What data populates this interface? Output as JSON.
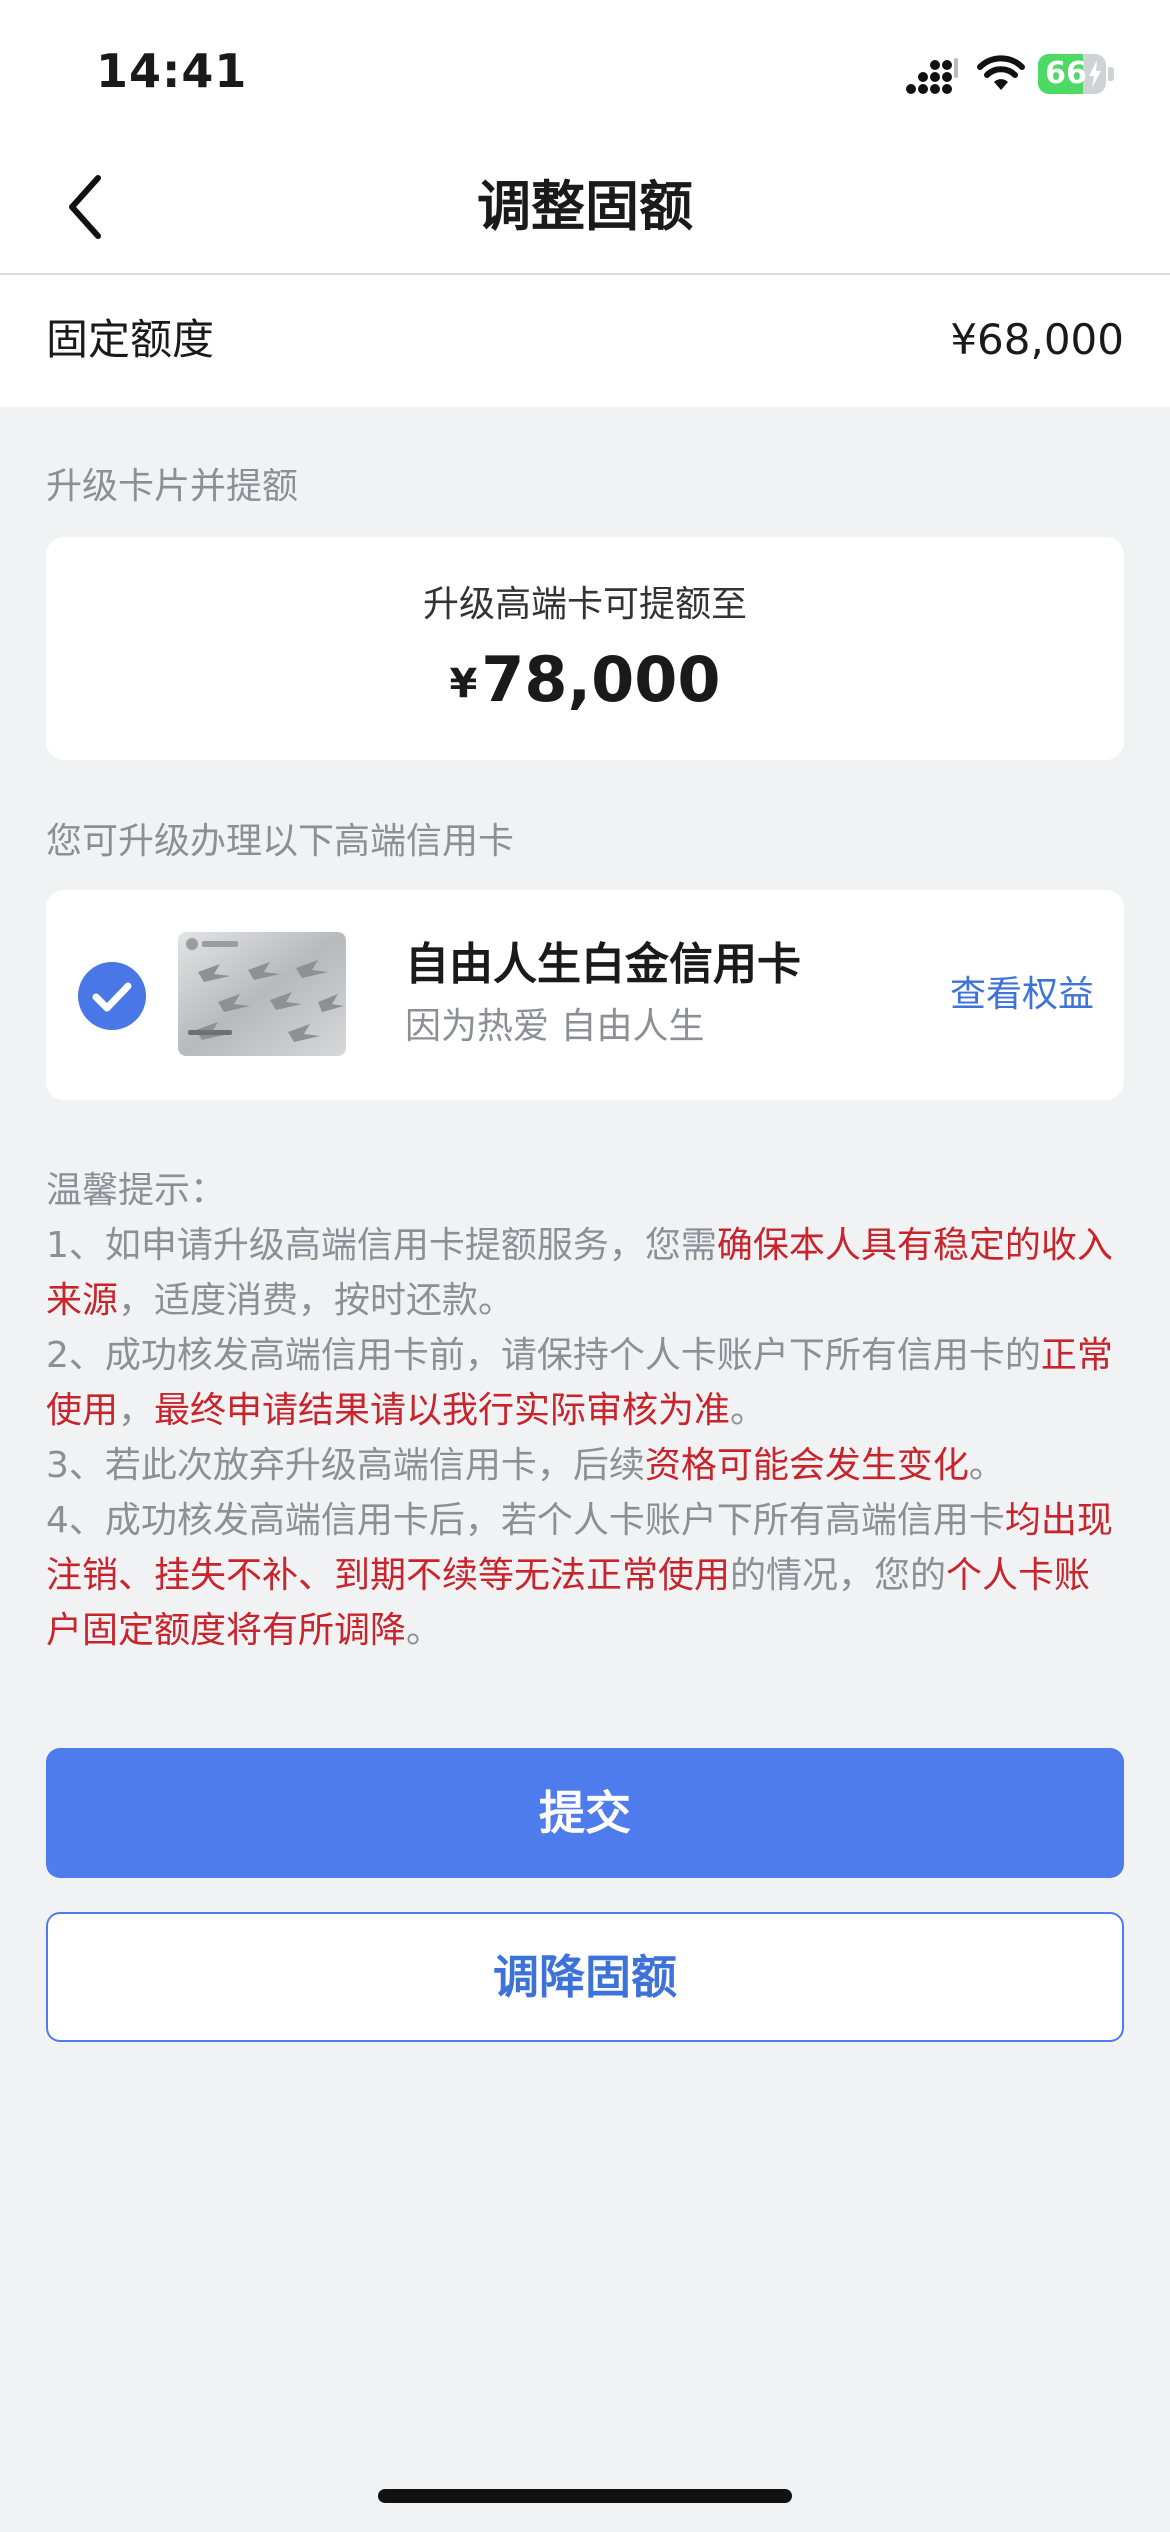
{
  "status_bar": {
    "time": "14:41",
    "battery_level": "66",
    "battery_fill_percent": 66,
    "icons": [
      "signal-icon",
      "wifi-icon",
      "battery-charging-icon"
    ]
  },
  "nav": {
    "title": "调整固额",
    "back_icon": "chevron-left-icon"
  },
  "fixed_limit": {
    "label": "固定额度",
    "value": "¥68,000"
  },
  "upgrade_section": {
    "label": "升级卡片并提额",
    "card_text": "升级高端卡可提额至",
    "amount_symbol": "¥",
    "amount": "78,000"
  },
  "card_section": {
    "label": "您可升级办理以下高端信用卡",
    "card": {
      "name": "自由人生白金信用卡",
      "slogan": "因为热爱 自由人生",
      "link_label": "查看权益",
      "selected": true
    }
  },
  "tips": {
    "title": "温馨提示：",
    "items": [
      [
        {
          "text": "1、如申请升级高端信用卡提额服务，您需",
          "red": false
        },
        {
          "text": "确保本人具有稳定的收入来源",
          "red": true
        },
        {
          "text": "，适度消费，按时还款。",
          "red": false
        }
      ],
      [
        {
          "text": "2、成功核发高端信用卡前，请保持个人卡账户下所有信用卡的",
          "red": false
        },
        {
          "text": "正常使用",
          "red": true
        },
        {
          "text": "，",
          "red": false
        },
        {
          "text": "最终申请结果请以我行实际审核为准",
          "red": true
        },
        {
          "text": "。",
          "red": false
        }
      ],
      [
        {
          "text": "3、若此次放弃升级高端信用卡，后续",
          "red": false
        },
        {
          "text": "资格可能会发生变化",
          "red": true
        },
        {
          "text": "。",
          "red": false
        }
      ],
      [
        {
          "text": "4、成功核发高端信用卡后，若个人卡账户下所有高端信用卡",
          "red": false
        },
        {
          "text": "均出现注销、挂失不补、到期不续等无法正常使用",
          "red": true
        },
        {
          "text": "的情况，您的",
          "red": false
        },
        {
          "text": "个人卡账户固定额度将有所调降",
          "red": true
        },
        {
          "text": "。",
          "red": false
        }
      ]
    ]
  },
  "buttons": {
    "submit": "提交",
    "lower_limit": "调降固额"
  },
  "colors": {
    "primary": "#4f7cec",
    "link": "#3d72d8",
    "warning_red": "#c8242b",
    "background": "#f1f2f4"
  }
}
